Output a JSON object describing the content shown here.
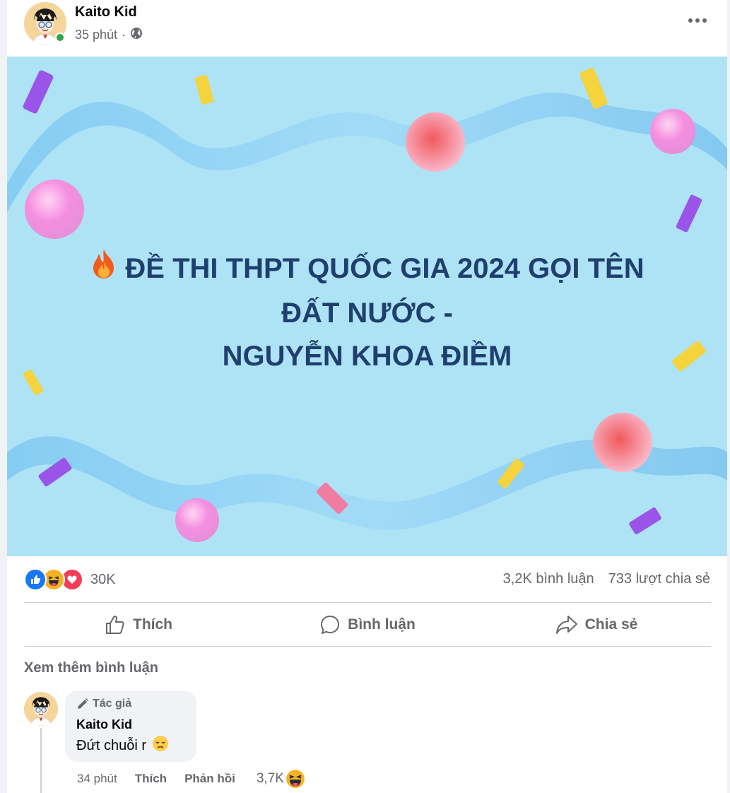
{
  "post": {
    "author": "Kaito Kid",
    "time": "35 phút",
    "separator": "·",
    "privacy_icon": "globe-icon",
    "more_icon": "ellipsis-icon",
    "image": {
      "title_line1": "ĐỀ THI THPT QUỐC GIA 2024 GỌI TÊN",
      "title_line2": "ĐẤT NƯỚC -",
      "title_line3": "NGUYỄN KHOA ĐIỀM",
      "leading_icon": "fire-emoji",
      "background_color": "#aee3f6",
      "text_color": "#1f3f6e"
    }
  },
  "stats": {
    "reaction_icons": [
      "like-icon",
      "haha-icon",
      "love-icon"
    ],
    "reaction_count": "30K",
    "comments": "3,2K bình luận",
    "shares": "733 lượt chia sẻ"
  },
  "actions": {
    "like": "Thích",
    "comment": "Bình luận",
    "share": "Chia sẻ"
  },
  "comments": {
    "view_more": "Xem thêm bình luận",
    "items": [
      {
        "badge": "Tác giả",
        "name": "Kaito Kid",
        "text": "Đứt chuỗi r",
        "emoji": "disappointed-emoji",
        "time": "34 phút",
        "like": "Thích",
        "reply": "Phản hồi",
        "reaction_count": "3,7K",
        "reaction_icon": "haha-icon"
      }
    ]
  },
  "colors": {
    "secondary_text": "#65676b",
    "like_blue": "#1877f2",
    "love_red": "#f33e58",
    "online_green": "#31a24c"
  }
}
